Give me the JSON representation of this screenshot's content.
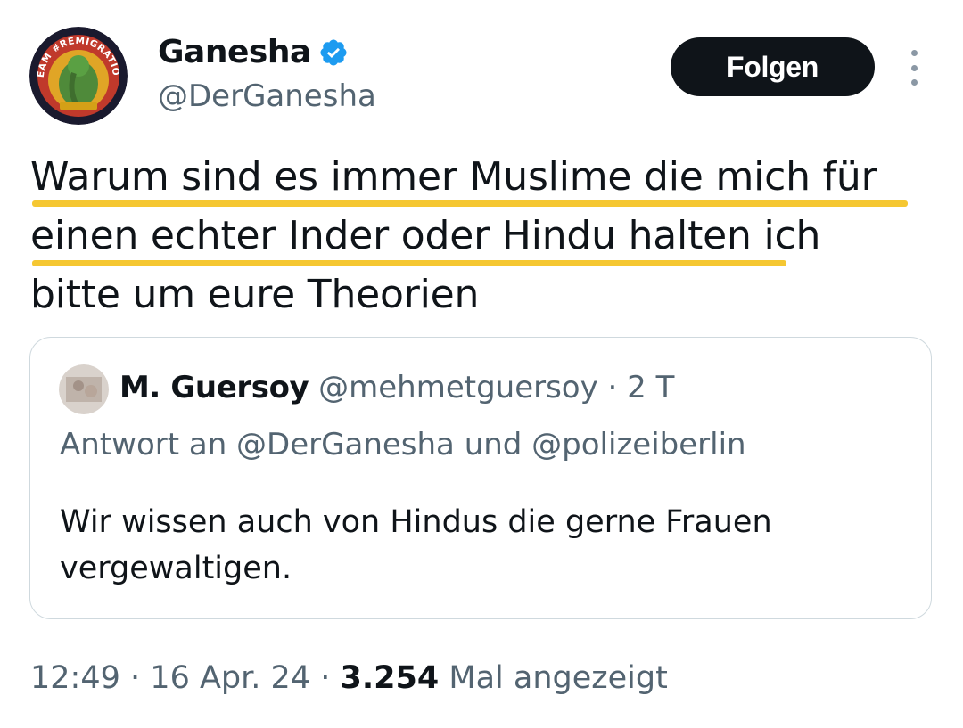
{
  "author": {
    "display_name": "Ganesha",
    "handle": "@DerGanesha",
    "avatar_text": "TEAM #REMIGRATION",
    "verified": true
  },
  "follow_button_label": "Folgen",
  "tweet": {
    "lines": [
      "Warum sind es immer Muslime die mich für",
      "einen echter Inder oder Hindu halten  ich",
      "bitte um eure Theorien"
    ]
  },
  "quoted_tweet": {
    "author_name": "M. Guersoy",
    "author_handle": "@mehmetguersoy",
    "separator": "·",
    "time": "2 T",
    "reply_to": "Antwort an @DerGanesha und @polizeiberlin",
    "body": "Wir wissen auch von Hindus die gerne Frauen vergewaltigen."
  },
  "meta": {
    "time": "12:49",
    "separator": "·",
    "date": "16 Apr. 24",
    "views_count": "3.254",
    "views_label": "Mal angezeigt"
  },
  "colors": {
    "text": "#0f1419",
    "secondary": "#536471",
    "highlight": "#f5c732",
    "verified": "#1d9bf0",
    "button_bg": "#0f1419"
  }
}
